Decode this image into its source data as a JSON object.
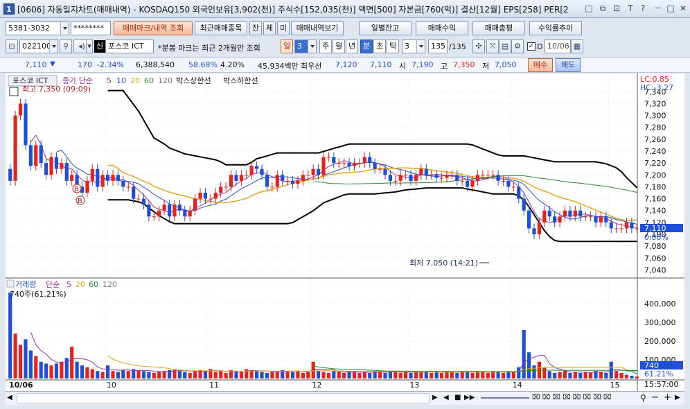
{
  "window": {
    "title": "[0606] 자동일지차트(매매내역) - KOSDAQ150 외국인보유[3,902(천)] 주식수[152,035(천)] 액면[500] 자본금[760(억)] 결산[12월] EPS[258] PER[2",
    "app_icon": "1",
    "controls": [
      "□",
      "⧉",
      "⊡",
      "T",
      "?",
      "－",
      "□",
      "✕"
    ]
  },
  "toolbar1": {
    "account": "5381-3032",
    "password": "********",
    "buttons": [
      "매매마크/내역 조회",
      "최근매매종목",
      "잔",
      "체",
      "미",
      "매매내역보기",
      "일별잔고",
      "매매수익",
      "매매총평",
      "수익률추이"
    ]
  },
  "toolbar2": {
    "code": "022100",
    "stock_badge": "신",
    "stock_name": "포스코 ICT",
    "note": "*분봉 마크는 최근 2개월만 조회",
    "period_label": "일",
    "interval": "3",
    "tf_options": [
      "주",
      "월",
      "년",
      "분",
      "초",
      "틱"
    ],
    "tf_active": "분",
    "count": "3",
    "range": "135",
    "range_total": "/135",
    "check_label": "D",
    "date": "10/06"
  },
  "pricebar": {
    "price": "7,110",
    "direction": "▼",
    "change": "170",
    "change_pct": "-2.34%",
    "volume": "6,388,540",
    "volume_ratio": "58.68%",
    "turnover": "4.20%",
    "amount": "45,934백만",
    "best_bid_label": "최우선",
    "best_ask": "7,120",
    "best_bid": "7,110",
    "open_label": "시",
    "open": "7,190",
    "high_label": "고",
    "high": "7,350",
    "low_label": "저",
    "low": "7,050",
    "buy_label": "매수",
    "sell_label": "매도"
  },
  "price_panel": {
    "legend": [
      "포스코 ICT",
      "종가 단순",
      "5",
      "10",
      "20",
      "60",
      "120",
      "박스상한선",
      "박스하한선"
    ],
    "high_label": "최고 7,350 (09:09)",
    "low_label": "최저 7,050 (14:21)",
    "lc": "LC:0.85",
    "hc": "HC:-3.27",
    "current_price_tag": "7,110",
    "current_pct_tag": "0.00%",
    "trade_marks": [
      "B",
      "B"
    ]
  },
  "volume_panel": {
    "legend": [
      "거래량",
      "단순",
      "5",
      "20",
      "60",
      "120"
    ],
    "first_bar_label": "740주(61.21%)",
    "current_tag": "740",
    "current_pct_tag": "61.21%",
    "yticks": [
      "400,000",
      "300,000",
      "200,000",
      "100,000"
    ]
  },
  "xaxis": {
    "labels": [
      "10/06",
      "10",
      "11",
      "12",
      "13",
      "14",
      "15"
    ],
    "time": "15:57:00"
  },
  "colors": {
    "up": "#e8211c",
    "down": "#1f4fd6",
    "ma5": "#9b2fa3",
    "ma10": "#1f4fd6",
    "ma20": "#e8a51c",
    "ma60": "#2a8c2a",
    "box": "#000000",
    "tag_bg": "#1f4fd6"
  },
  "chart_data": {
    "type": "candlestick",
    "title": "",
    "ylim": [
      7030,
      7345
    ],
    "yticks": [
      7340,
      7320,
      7300,
      7280,
      7260,
      7240,
      7220,
      7200,
      7180,
      7160,
      7140,
      7120,
      7100,
      7080,
      7060,
      7040
    ],
    "volume_ylim": [
      0,
      460000
    ],
    "volume_yticks": [
      400000,
      300000,
      200000,
      100000
    ],
    "x_labels": [
      {
        "i": 0,
        "label": "10/06"
      },
      {
        "i": 19,
        "label": "10"
      },
      {
        "i": 39,
        "label": "11"
      },
      {
        "i": 59,
        "label": "12"
      },
      {
        "i": 78,
        "label": "13"
      },
      {
        "i": 98,
        "label": "14"
      },
      {
        "i": 117,
        "label": "15"
      }
    ],
    "close": [
      7190,
      7300,
      7320,
      7250,
      7215,
      7250,
      7220,
      7200,
      7230,
      7210,
      7220,
      7190,
      7200,
      7180,
      7170,
      7190,
      7210,
      7180,
      7200,
      7190,
      7200,
      7190,
      7180,
      7180,
      7160,
      7160,
      7150,
      7130,
      7130,
      7140,
      7150,
      7130,
      7150,
      7140,
      7130,
      7140,
      7160,
      7170,
      7160,
      7160,
      7170,
      7180,
      7180,
      7200,
      7190,
      7200,
      7200,
      7215,
      7210,
      7200,
      7180,
      7180,
      7200,
      7190,
      7190,
      7185,
      7190,
      7200,
      7200,
      7210,
      7200,
      7230,
      7230,
      7220,
      7220,
      7220,
      7215,
      7220,
      7220,
      7230,
      7220,
      7210,
      7210,
      7200,
      7190,
      7190,
      7200,
      7200,
      7190,
      7200,
      7210,
      7200,
      7200,
      7195,
      7195,
      7200,
      7200,
      7190,
      7190,
      7180,
      7190,
      7200,
      7200,
      7200,
      7200,
      7190,
      7190,
      7180,
      7180,
      7160,
      7140,
      7110,
      7100,
      7120,
      7140,
      7130,
      7120,
      7130,
      7140,
      7130,
      7140,
      7130,
      7130,
      7130,
      7120,
      7130,
      7120,
      7110,
      7110,
      7110,
      7120,
      7110,
      7110
    ],
    "volume": [
      460000,
      240000,
      180000,
      210000,
      150000,
      120000,
      90000,
      80000,
      70000,
      80000,
      90000,
      110000,
      170000,
      90000,
      70000,
      60000,
      50000,
      40000,
      35000,
      70000,
      40000,
      35000,
      45000,
      40000,
      50000,
      45000,
      40000,
      35000,
      30000,
      35000,
      40000,
      45000,
      50000,
      40000,
      35000,
      30000,
      40000,
      45000,
      40000,
      50000,
      35000,
      40000,
      30000,
      45000,
      40000,
      35000,
      50000,
      45000,
      40000,
      35000,
      30000,
      35000,
      40000,
      45000,
      40000,
      35000,
      40000,
      30000,
      35000,
      90000,
      40000,
      35000,
      30000,
      40000,
      35000,
      30000,
      40000,
      35000,
      30000,
      35000,
      30000,
      40000,
      35000,
      30000,
      40000,
      35000,
      30000,
      35000,
      30000,
      40000,
      35000,
      40000,
      30000,
      35000,
      30000,
      40000,
      35000,
      30000,
      40000,
      35000,
      30000,
      40000,
      35000,
      30000,
      40000,
      35000,
      30000,
      40000,
      35000,
      60000,
      260000,
      140000,
      70000,
      90000,
      60000,
      40000,
      30000,
      35000,
      40000,
      30000,
      35000,
      30000,
      35000,
      30000,
      40000,
      35000,
      30000,
      90000,
      40000,
      30000,
      20000,
      15000,
      10000
    ]
  }
}
